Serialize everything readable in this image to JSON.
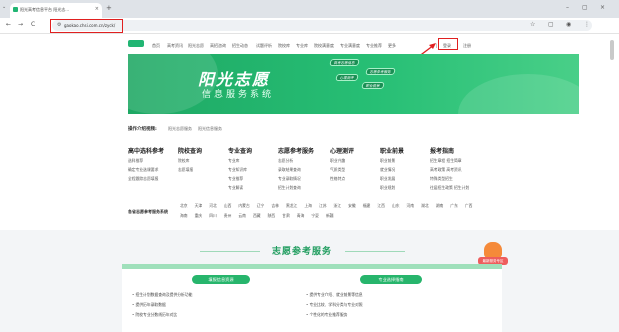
{
  "browser": {
    "tab_title": "阳光高考信息平台 阳光志...",
    "tab_close": "×",
    "new_tab": "+",
    "url": "gaokao.chsi.com.cn/zyck/",
    "win_min": "–",
    "win_max": "▢",
    "win_close": "×",
    "nav_back": "←",
    "nav_forward": "→",
    "nav_reload": "C",
    "icons": [
      "dropdown-icon",
      "back-icon",
      "forward-icon",
      "reload-icon",
      "lock-icon",
      "star-icon",
      "profile-icon",
      "menu-icon"
    ]
  },
  "site": {
    "nav": [
      "首页",
      "高考资讯",
      "阳光志愿",
      "高招咨询",
      "招生动态",
      "试题评析",
      "院校库",
      "专业库",
      "院校满意度",
      "专业满意度",
      "专业推荐",
      "更多"
    ],
    "login": "登录",
    "register": "注册"
  },
  "hero": {
    "title": "阳光志愿",
    "subtitle": "信息服务系统",
    "tags": [
      "高考志愿信息",
      "志愿参考服务",
      "心理测评",
      "职业前景"
    ]
  },
  "function_nav": {
    "label": "操作介绍视频:",
    "items": [
      "阳光志愿服务",
      "阳光信息服务"
    ]
  },
  "categories": [
    {
      "title": "高中选科参考",
      "lines": [
        "选科推荐",
        "确定专业选课要求",
        "全程跟踪志愿填报"
      ]
    },
    {
      "title": "院校查询",
      "lines": [
        "院校库",
        "志愿填报"
      ]
    },
    {
      "title": "专业查询",
      "lines": [
        "专业库",
        "专业知识库",
        "专业推荐",
        "专业解读"
      ]
    },
    {
      "title": "志愿参考服务",
      "lines": [
        "志愿分析",
        "录取结果查询",
        "专业录取情况",
        "招生计划查询"
      ]
    },
    {
      "title": "心理测评",
      "lines": [
        "职业兴趣",
        "气质类型",
        "性格特点"
      ]
    },
    {
      "title": "职业前景",
      "lines": [
        "职业前景",
        "就业情况",
        "职业发展",
        "职业规划"
      ]
    },
    {
      "title": "报考指南",
      "lines": [
        "招生章程 招生简章",
        "高考政策 高考资讯",
        "特殊类型招生",
        "往届招生政策 招生计划"
      ]
    }
  ],
  "provinces": {
    "label": "各省志愿参考服务系统",
    "row1": [
      "北京",
      "天津",
      "河北",
      "山西",
      "内蒙古",
      "辽宁",
      "吉林",
      "黑龙江",
      "上海",
      "江苏",
      "浙江",
      "安徽",
      "福建",
      "江西",
      "山东",
      "河南",
      "湖北",
      "湖南",
      "广东",
      "广西"
    ],
    "row2": [
      "海南",
      "重庆",
      "四川",
      "贵州",
      "云南",
      "西藏",
      "陕西",
      "甘肃",
      "青海",
      "宁夏",
      "新疆"
    ]
  },
  "service": {
    "title": "志愿参考服务",
    "badge": "最新服务专区",
    "left_card": {
      "label": "填报信息资源",
      "bullets": [
        "招生计划数据查询及提供分析功能",
        "提供历年录取数据",
        "院校专业分数线历年对比"
      ]
    },
    "right_card": {
      "label": "专业选择指南",
      "bullets": [
        "提供专业介绍、就业前景等信息",
        "专业比较、学科分类与专业对照",
        "个性化的专业推荐服务"
      ]
    }
  }
}
